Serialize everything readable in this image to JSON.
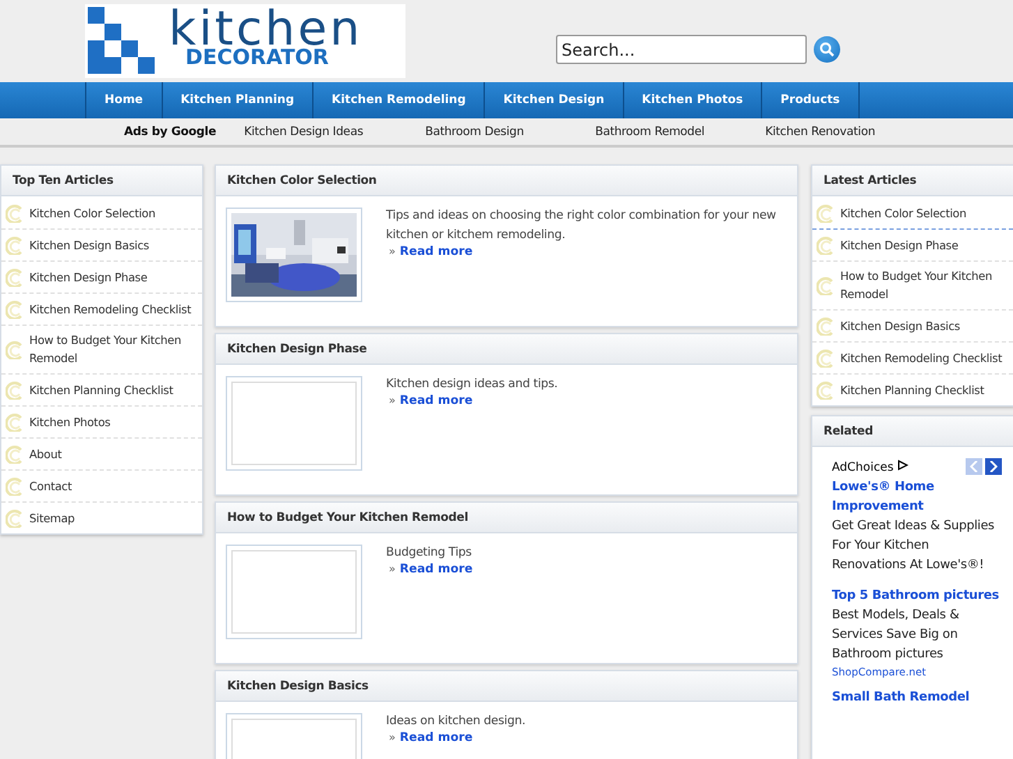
{
  "logo": {
    "word": "kitchen",
    "subword": "DECORATOR"
  },
  "search": {
    "placeholder": "Search..."
  },
  "nav": [
    "Home",
    "Kitchen Planning",
    "Kitchen Remodeling",
    "Kitchen Design",
    "Kitchen Photos",
    "Products"
  ],
  "ad_links": {
    "label": "Ads by Google",
    "links": [
      "Kitchen Design Ideas",
      "Bathroom Design",
      "Bathroom Remodel",
      "Kitchen Renovation"
    ]
  },
  "top_ten": {
    "title": "Top Ten Articles",
    "items": [
      "Kitchen Color Selection",
      "Kitchen Design Basics",
      "Kitchen Design Phase",
      "Kitchen Remodeling Checklist",
      "How to Budget Your Kitchen Remodel",
      "Kitchen Planning Checklist",
      "Kitchen Photos",
      "About",
      "Contact",
      "Sitemap"
    ]
  },
  "articles": [
    {
      "title": "Kitchen Color Selection",
      "summary": "Tips and ideas on choosing the right color combination for your new kitchen or kitchem remodeling.",
      "more": "Read more",
      "marker": "»",
      "has_picture": true
    },
    {
      "title": "Kitchen Design Phase",
      "summary": "Kitchen design ideas and tips.",
      "more": "Read more",
      "marker": "»",
      "has_picture": false
    },
    {
      "title": "How to Budget Your Kitchen Remodel",
      "summary": "Budgeting Tips",
      "more": "Read more",
      "marker": "»",
      "has_picture": false
    },
    {
      "title": "Kitchen Design Basics",
      "summary": "Ideas on kitchen design.",
      "more": "Read more",
      "marker": "»",
      "has_picture": false
    }
  ],
  "latest": {
    "title": "Latest Articles",
    "items": [
      "Kitchen Color Selection",
      "Kitchen Design Phase",
      "How to Budget Your Kitchen Remodel",
      "Kitchen Design Basics",
      "Kitchen Remodeling Checklist",
      "Kitchen Planning Checklist"
    ]
  },
  "related": {
    "title": "Related",
    "adchoices": "AdChoices",
    "ads": [
      {
        "headline": "Lowe's® Home Improvement",
        "body": "Get Great Ideas & Supplies For Your Kitchen Renovations At Lowe's®!"
      },
      {
        "headline": "Top 5 Bathroom pictures",
        "body": "Best Models, Deals & Services Save Big on Bathroom pictures",
        "source": "ShopCompare.net"
      },
      {
        "headline": "Small Bath Remodel"
      }
    ]
  }
}
